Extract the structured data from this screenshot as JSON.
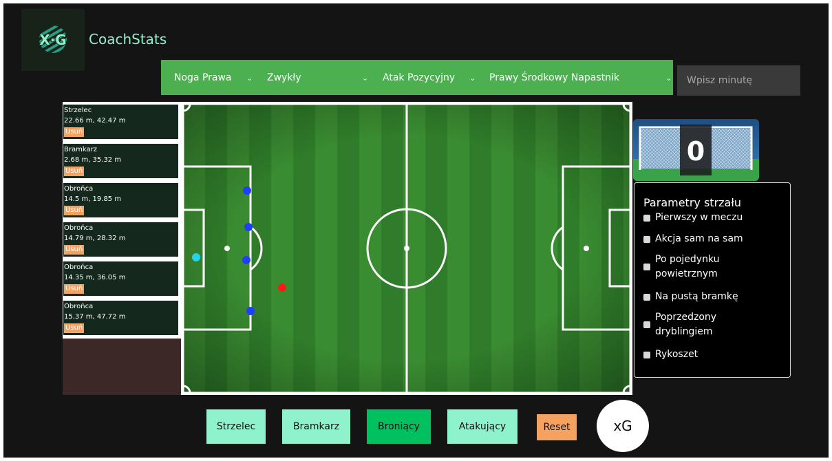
{
  "app": {
    "title": "CoachStats",
    "logo_text": "X·G"
  },
  "filters": [
    {
      "label": "Noga Prawa"
    },
    {
      "label": "Zwykły"
    },
    {
      "label": "Atak Pozycyjny"
    },
    {
      "label": "Prawy Środkowy Napastnik"
    }
  ],
  "minute_input": {
    "placeholder": "Wpisz minutę",
    "value": ""
  },
  "players": [
    {
      "role": "Strzelec",
      "coords": "22.66 m, 42.47 m",
      "remove_label": "Usuń"
    },
    {
      "role": "Bramkarz",
      "coords": "2.68 m, 35.32 m",
      "remove_label": "Usuń"
    },
    {
      "role": "Obrońca",
      "coords": "14.5 m, 19.85 m",
      "remove_label": "Usuń"
    },
    {
      "role": "Obrońca",
      "coords": "14.79 m, 28.32 m",
      "remove_label": "Usuń"
    },
    {
      "role": "Obrońca",
      "coords": "14.35 m, 36.05 m",
      "remove_label": "Usuń"
    },
    {
      "role": "Obrońca",
      "coords": "15.37 m, 47.72 m",
      "remove_label": "Usuń"
    }
  ],
  "pitch_markers": {
    "shooter_color": "#ff1a1a",
    "goalkeeper_color": "#22d3ee",
    "defender_color": "#1f3fff"
  },
  "goal_score": "0",
  "shot_params": {
    "title": "Parametry strzału",
    "items": [
      {
        "label": "Pierwszy w meczu",
        "checked": false
      },
      {
        "label": "Akcja sam na sam",
        "checked": false
      },
      {
        "label": "Po pojedynku powietrznym",
        "checked": false
      },
      {
        "label": "Na pustą bramkę",
        "checked": false
      },
      {
        "label": "Poprzedzony dryblingiem",
        "checked": false
      },
      {
        "label": "Rykoszet",
        "checked": false
      }
    ]
  },
  "buttons": {
    "shooter": "Strzelec",
    "goalkeeper": "Bramkarz",
    "defender": "Broniący",
    "attacker": "Atakujący",
    "reset": "Reset",
    "xg": "xG"
  },
  "colors": {
    "accent": "#8ef2cc",
    "active": "#00c060",
    "filter_bar": "#4caf50",
    "reset": "#f5a261",
    "card": "#15281e"
  }
}
